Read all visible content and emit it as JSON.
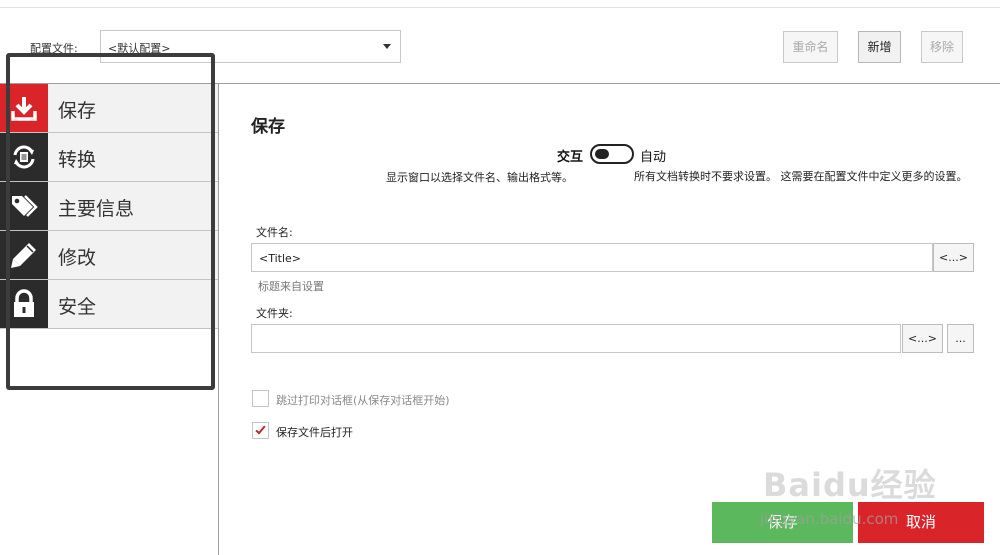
{
  "header": {
    "profile_label": "配置文件:",
    "profile_value": "<默认配置>",
    "rename_label": "重命名",
    "new_label": "新增",
    "remove_label": "移除"
  },
  "sidebar": {
    "items": [
      {
        "label": "保存",
        "icon": "download-icon",
        "active": true
      },
      {
        "label": "转换",
        "icon": "convert-icon",
        "active": false
      },
      {
        "label": "主要信息",
        "icon": "tags-icon",
        "active": false
      },
      {
        "label": "修改",
        "icon": "pencil-icon",
        "active": false
      },
      {
        "label": "安全",
        "icon": "lock-icon",
        "active": false
      }
    ]
  },
  "main": {
    "title": "保存",
    "mode": {
      "interactive_label": "交互",
      "auto_label": "自动",
      "interactive_desc": "显示窗口以选择文件名、输出格式等。",
      "auto_desc": "所有文档转换时不要求设置。 这需要在配置文件中定义更多的设置。"
    },
    "filename": {
      "label": "文件名:",
      "value": "<Title>",
      "token_button": "<...>",
      "hint": "标题来自设置"
    },
    "folder": {
      "label": "文件夹:",
      "value": "",
      "token_button": "<...>",
      "browse_button": "..."
    },
    "options": {
      "skip_print_dialog": {
        "label": "跳过打印对话框(从保存对话框开始)",
        "checked": false,
        "enabled": false
      },
      "open_after_save": {
        "label": "保存文件后打开",
        "checked": true,
        "enabled": true
      }
    }
  },
  "footer": {
    "save_label": "保存",
    "cancel_label": "取消"
  },
  "watermark": {
    "logo_text": "Baidu经验",
    "url": "jingyan.baidu.com"
  },
  "colors": {
    "accent_red": "#d9252a",
    "save_green": "#5cb85c",
    "sidebar_icon_bg": "#2b2b2b"
  }
}
